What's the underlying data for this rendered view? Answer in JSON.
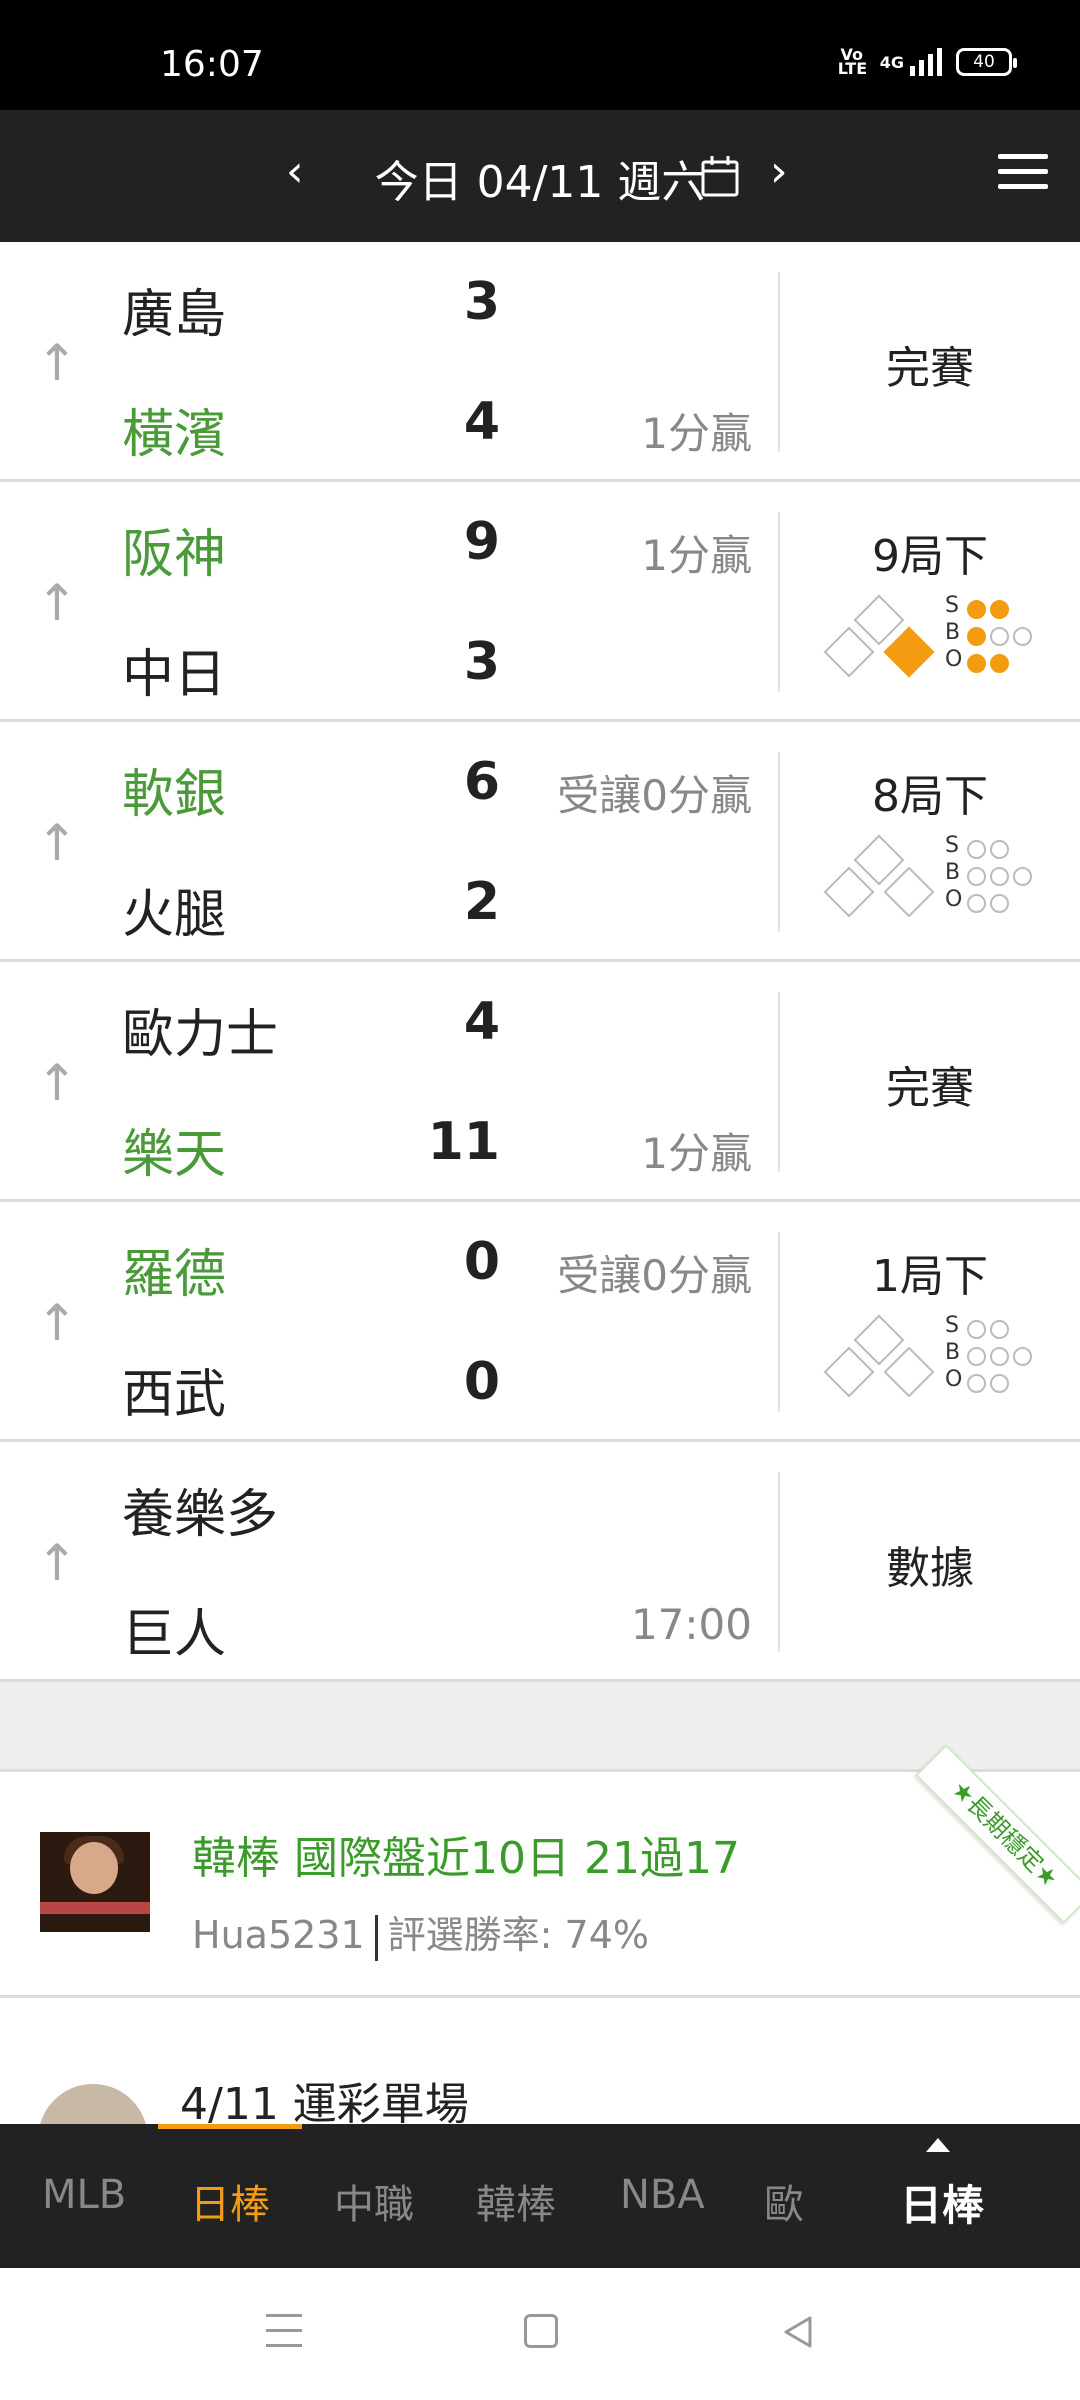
{
  "status_bar": {
    "time": "16:07",
    "network": "4G",
    "volte": "Vo LTE",
    "battery": "40"
  },
  "header": {
    "date": "今日 04/11 週六",
    "prev_icon": "chevron-left-icon",
    "next_icon": "chevron-right-icon",
    "calendar_icon": "calendar-icon",
    "menu_icon": "menu-icon"
  },
  "games": [
    {
      "team1": "廣島",
      "score1": "3",
      "note1": "",
      "team2": "橫濱",
      "score2": "4",
      "note2": "1分贏",
      "winner": 2,
      "status": "完賽"
    },
    {
      "team1": "阪神",
      "score1": "9",
      "note1": "1分贏",
      "team2": "中日",
      "score2": "3",
      "note2": "",
      "winner": 1,
      "status": "9局下"
    },
    {
      "team1": "軟銀",
      "score1": "6",
      "note1": "受讓0分贏",
      "team2": "火腿",
      "score2": "2",
      "note2": "",
      "winner": 1,
      "status": "8局下"
    },
    {
      "team1": "歐力士",
      "score1": "4",
      "note1": "",
      "team2": "樂天",
      "score2": "11",
      "note2": "1分贏",
      "winner": 2,
      "status": "完賽"
    },
    {
      "team1": "羅德",
      "score1": "0",
      "note1": "受讓0分贏",
      "team2": "西武",
      "score2": "0",
      "note2": "",
      "winner": 1,
      "status": "1局下"
    },
    {
      "team1": "養樂多",
      "score1": "",
      "note1": "",
      "team2": "巨人",
      "score2": "",
      "note2": "17:00",
      "winner": 0,
      "status": "數據"
    }
  ],
  "sbo_labels": {
    "s": "S",
    "b": "B",
    "o": "O"
  },
  "promo": {
    "title": "韓棒 國際盤近10日 21過17",
    "user": "Hua5231",
    "rate": "評選勝率: 74%",
    "ribbon": "★長期穩定★"
  },
  "promo2": {
    "title": "4/11 運彩單場"
  },
  "tabs": [
    "MLB",
    "日棒",
    "中職",
    "韓棒",
    "NBA",
    "歐"
  ],
  "current_tab": "日棒",
  "colors": {
    "accent": "#f39c12",
    "win": "#4a9a3a",
    "header_bg": "#222222"
  }
}
